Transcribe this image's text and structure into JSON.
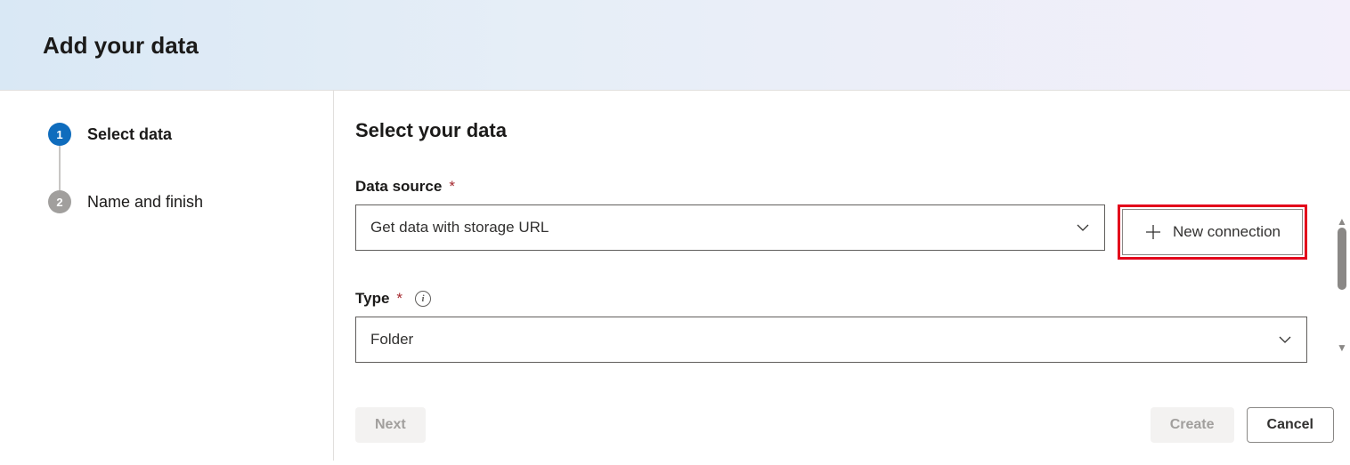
{
  "header": {
    "title": "Add your data"
  },
  "sidebar": {
    "steps": [
      {
        "num": "1",
        "label": "Select data",
        "active": true
      },
      {
        "num": "2",
        "label": "Name and finish",
        "active": false
      }
    ]
  },
  "main": {
    "heading": "Select your data",
    "dataSource": {
      "label": "Data source",
      "value": "Get data with storage URL",
      "newConnection": "New connection"
    },
    "type": {
      "label": "Type",
      "value": "Folder"
    }
  },
  "footer": {
    "next": "Next",
    "create": "Create",
    "cancel": "Cancel"
  }
}
